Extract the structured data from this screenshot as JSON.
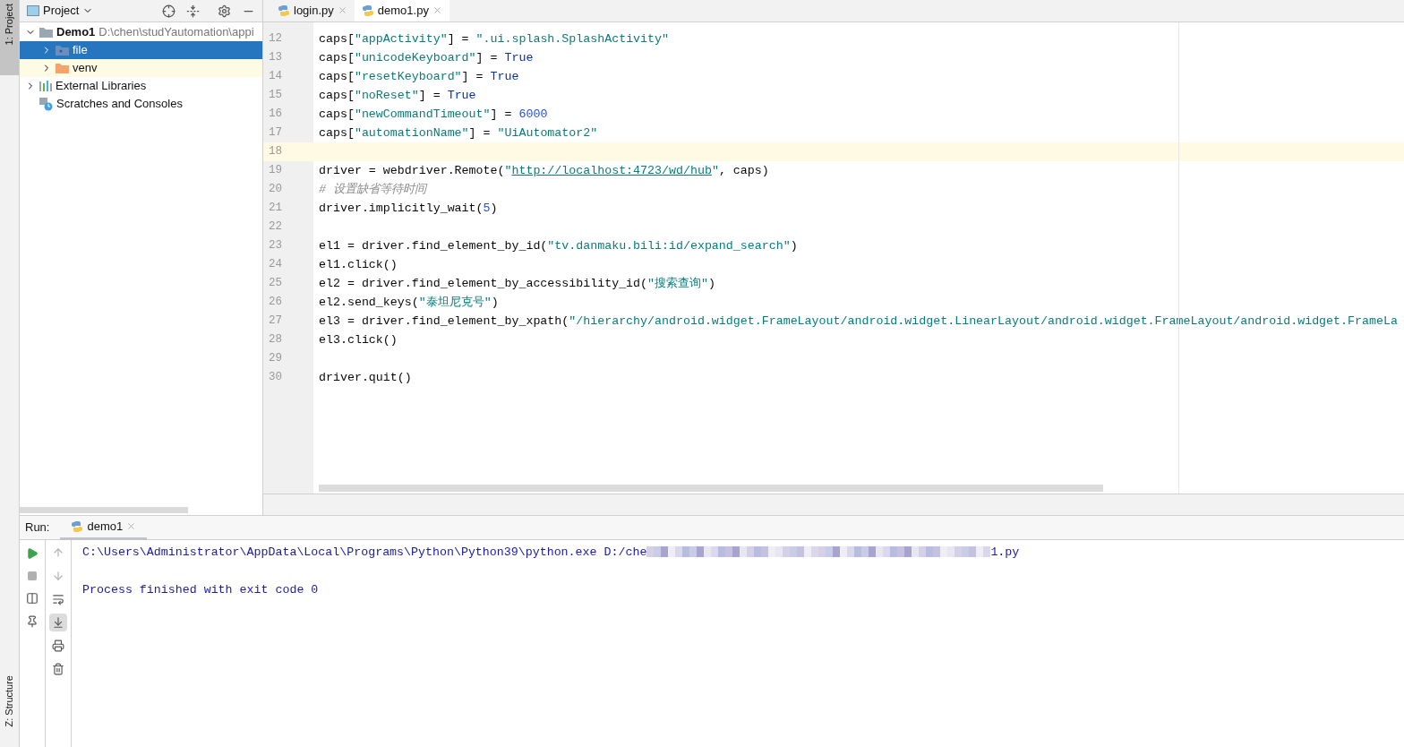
{
  "side_stripe": {
    "top": "1: Project",
    "bottom": "Z: Structure"
  },
  "project_panel": {
    "title": "Project",
    "tree": [
      {
        "label": "Demo1",
        "path": "D:\\chen\\studYautomation\\appi",
        "kind": "module",
        "expanded": true,
        "selected": false,
        "children": [
          {
            "label": "file",
            "kind": "source-folder",
            "expanded": false,
            "selected": true
          },
          {
            "label": "venv",
            "kind": "excluded-folder",
            "expanded": false,
            "selected": false
          }
        ]
      },
      {
        "label": "External Libraries",
        "kind": "libraries",
        "expanded": false,
        "selected": false
      },
      {
        "label": "Scratches and Consoles",
        "kind": "scratches",
        "selected": false
      }
    ]
  },
  "editor": {
    "tabs": [
      {
        "label": "login.py",
        "selected": false
      },
      {
        "label": "demo1.py",
        "selected": true
      }
    ],
    "lines": [
      {
        "number": "12",
        "current": false,
        "segments": [
          {
            "kind": "plain",
            "text": "caps["
          },
          {
            "kind": "string",
            "text": "\"appActivity\""
          },
          {
            "kind": "plain",
            "text": "] = "
          },
          {
            "kind": "string",
            "text": "\".ui.splash.SplashActivity\""
          }
        ]
      },
      {
        "number": "13",
        "current": false,
        "segments": [
          {
            "kind": "plain",
            "text": "caps["
          },
          {
            "kind": "string",
            "text": "\"unicodeKeyboard\""
          },
          {
            "kind": "plain",
            "text": "] = "
          },
          {
            "kind": "keyword",
            "text": "True"
          }
        ]
      },
      {
        "number": "14",
        "current": false,
        "segments": [
          {
            "kind": "plain",
            "text": "caps["
          },
          {
            "kind": "string",
            "text": "\"resetKeyboard\""
          },
          {
            "kind": "plain",
            "text": "] = "
          },
          {
            "kind": "keyword",
            "text": "True"
          }
        ]
      },
      {
        "number": "15",
        "current": false,
        "segments": [
          {
            "kind": "plain",
            "text": "caps["
          },
          {
            "kind": "string",
            "text": "\"noReset\""
          },
          {
            "kind": "plain",
            "text": "] = "
          },
          {
            "kind": "keyword",
            "text": "True"
          }
        ]
      },
      {
        "number": "16",
        "current": false,
        "segments": [
          {
            "kind": "plain",
            "text": "caps["
          },
          {
            "kind": "string",
            "text": "\"newCommandTimeout\""
          },
          {
            "kind": "plain",
            "text": "] = "
          },
          {
            "kind": "number",
            "text": "6000"
          }
        ]
      },
      {
        "number": "17",
        "current": false,
        "segments": [
          {
            "kind": "plain",
            "text": "caps["
          },
          {
            "kind": "string",
            "text": "\"automationName\""
          },
          {
            "kind": "plain",
            "text": "] = "
          },
          {
            "kind": "string",
            "text": "\"UiAutomator2\""
          }
        ]
      },
      {
        "number": "18",
        "current": true
      },
      {
        "number": "19",
        "current": false,
        "segments": [
          {
            "kind": "plain",
            "text": "driver = webdriver.Remote("
          },
          {
            "kind": "string",
            "text": "\""
          },
          {
            "kind": "link",
            "text": "http://localhost:4723/wd/hub"
          },
          {
            "kind": "string",
            "text": "\""
          },
          {
            "kind": "plain",
            "text": ", caps)"
          }
        ]
      },
      {
        "number": "20",
        "current": false,
        "segments": [
          {
            "kind": "comment",
            "text": "#  设置缺省等待时间"
          }
        ]
      },
      {
        "number": "21",
        "current": false,
        "segments": [
          {
            "kind": "plain",
            "text": "driver.implicitly_wait("
          },
          {
            "kind": "number",
            "text": "5"
          },
          {
            "kind": "plain",
            "text": ")"
          }
        ]
      },
      {
        "number": "22",
        "current": false
      },
      {
        "number": "23",
        "current": false,
        "segments": [
          {
            "kind": "plain",
            "text": "el1 = driver.find_element_by_id("
          },
          {
            "kind": "string",
            "text": "\"tv.danmaku.bili:id/expand_search\""
          },
          {
            "kind": "plain",
            "text": ")"
          }
        ]
      },
      {
        "number": "24",
        "current": false,
        "segments": [
          {
            "kind": "plain",
            "text": "el1.click()"
          }
        ]
      },
      {
        "number": "25",
        "current": false,
        "segments": [
          {
            "kind": "plain",
            "text": "el2 = driver.find_element_by_accessibility_id("
          },
          {
            "kind": "string",
            "text": "\"搜索查询\""
          },
          {
            "kind": "plain",
            "text": ")"
          }
        ]
      },
      {
        "number": "26",
        "current": false,
        "segments": [
          {
            "kind": "plain",
            "text": "el2.send_keys("
          },
          {
            "kind": "string",
            "text": "\"泰坦尼克号\""
          },
          {
            "kind": "plain",
            "text": ")"
          }
        ]
      },
      {
        "number": "27",
        "current": false,
        "segments": [
          {
            "kind": "plain",
            "text": "el3 = driver.find_element_by_xpath("
          },
          {
            "kind": "string",
            "text": "\"/hierarchy/android.widget.FrameLayout/android.widget.LinearLayout/android.widget.FrameLayout/android.widget.FrameLa"
          }
        ]
      },
      {
        "number": "28",
        "current": false,
        "segments": [
          {
            "kind": "plain",
            "text": "el3.click()"
          }
        ]
      },
      {
        "number": "29",
        "current": false
      },
      {
        "number": "30",
        "current": false,
        "segments": [
          {
            "kind": "plain",
            "text": "driver.quit()"
          }
        ]
      }
    ]
  },
  "run_panel": {
    "label": "Run:",
    "tab": "demo1",
    "left_toolbar": [
      {
        "kind": "run",
        "disabled": false
      },
      {
        "kind": "stop",
        "disabled": true
      },
      {
        "kind": "layout",
        "disabled": false
      },
      {
        "kind": "pin",
        "disabled": false
      }
    ],
    "console_toolbar": [
      {
        "kind": "up",
        "on": false
      },
      {
        "kind": "down",
        "on": false
      },
      {
        "kind": "wrap",
        "on": false
      },
      {
        "kind": "scroll-end",
        "on": true
      },
      {
        "kind": "print",
        "on": false
      },
      {
        "kind": "trash",
        "on": false
      }
    ],
    "console": [
      {
        "segments": [
          {
            "kind": "text",
            "text": "C:\\Users\\Administrator\\AppData\\Local\\Programs\\Python\\Python39\\python.exe D:/che"
          },
          {
            "kind": "redacted"
          },
          {
            "kind": "text",
            "text": "1.py"
          }
        ]
      },
      {
        "segments": [
          {
            "kind": "text",
            "text": "Process finished with exit code 0"
          }
        ]
      }
    ]
  }
}
